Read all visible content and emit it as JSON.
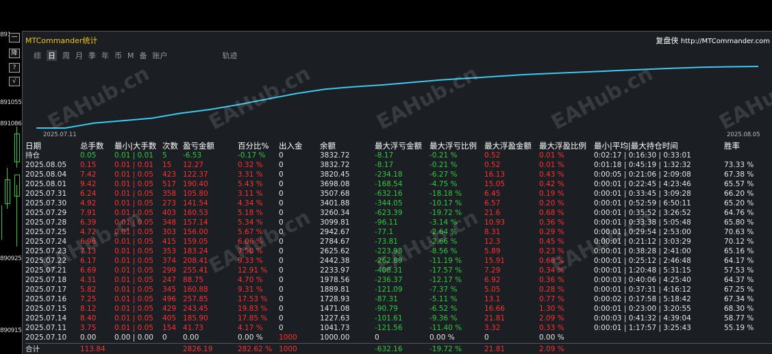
{
  "window": {
    "title": "MTCommander统计",
    "brand": "复盘侠",
    "url": "http://MTCommander.com"
  },
  "tabs": [
    "综",
    "日",
    "周",
    "月",
    "季",
    "年",
    "币",
    "M",
    "备",
    "账户",
    "轨迹"
  ],
  "active_tab": "日",
  "price_labels": [
    "891",
    "891055",
    "891086",
    "890925",
    "890915"
  ],
  "tool_buttons": [
    "一",
    "降",
    "?",
    "√"
  ],
  "chart": {
    "start_label": "2025.07.11",
    "end_label": "2025.08.05",
    "line_color": "#3ec9f2",
    "points": [
      0,
      0,
      0.08,
      0.12,
      0.16,
      0.24,
      0.3,
      0.38,
      0.47,
      0.56,
      0.63,
      0.67,
      0.7,
      0.74,
      0.78,
      0.81,
      0.84,
      0.87,
      0.89,
      0.91,
      0.93,
      0.95,
      0.97,
      0.985,
      0.995,
      1.0
    ]
  },
  "table": {
    "headers": [
      "日期",
      "总手数",
      "最小|大手数",
      "次数",
      "盈亏金额",
      "百分比%",
      "出入金",
      "余额",
      "最大浮亏金额",
      "最大浮亏比例",
      "最大浮盈金额",
      "最大浮盈比例",
      "最小|平均|最大持仓时间",
      "胜率"
    ],
    "holding": {
      "label": "持仓",
      "lots": "0.05",
      "minmax": "0.01 | 0.01",
      "count": "5",
      "pl": "-6.53",
      "pct": "-0.17 %",
      "io": "0",
      "balance": "3832.72",
      "max_float_loss": "-8.17",
      "max_float_loss_pct": "-0.21 %",
      "max_float_profit": "0.52",
      "max_float_profit_pct": "0.01 %",
      "hold_time": "0:02:17 | 0:16:30 | 0:33:01",
      "winrate": ""
    },
    "rows": [
      [
        "2025.08.05",
        "0.15",
        "0.01 | 0.01",
        "15",
        "12.27",
        "0.32 %",
        "0",
        "3832.72",
        "-8.17",
        "-0.21 %",
        "0.52",
        "0.01 %",
        "0:01:18 | 0:45:19 | 1:32:32",
        "73.33 %"
      ],
      [
        "2025.08.04",
        "7.42",
        "0.01 | 0.05",
        "423",
        "122.37",
        "3.31 %",
        "0",
        "3820.45",
        "-234.18",
        "-6.27 %",
        "16.13",
        "0.43 %",
        "0:00:05 | 0:21:06 | 2:09:08",
        "67.38 %"
      ],
      [
        "2025.08.01",
        "9.42",
        "0.01 | 0.05",
        "517",
        "190.40",
        "5.43 %",
        "0",
        "3698.08",
        "-168.54",
        "-4.75 %",
        "15.05",
        "0.42 %",
        "0:00:01 | 0:22:45 | 4:23:46",
        "65.57 %"
      ],
      [
        "2025.07.31",
        "6.24",
        "0.01 | 0.05",
        "358",
        "105.80",
        "3.11 %",
        "0",
        "3507.68",
        "-632.16",
        "-18.18 %",
        "6.45",
        "0.19 %",
        "0:00:01 | 0:33:45 | 3:09:28",
        "66.20 %"
      ],
      [
        "2025.07.30",
        "4.92",
        "0.01 | 0.05",
        "273",
        "141.54",
        "4.34 %",
        "0",
        "3401.88",
        "-344.05",
        "-10.17 %",
        "6.57",
        "0.20 %",
        "0:00:01 | 0:52:59 | 6:50:11",
        "65.20 %"
      ],
      [
        "2025.07.29",
        "7.91",
        "0.01 | 0.05",
        "403",
        "160.53",
        "5.18 %",
        "0",
        "3260.34",
        "-623.39",
        "-19.72 %",
        "21.6",
        "0.68 %",
        "0:00:01 | 0:35:52 | 3:26:52",
        "64.76 %"
      ],
      [
        "2025.07.28",
        "6.39",
        "0.01 | 0.05",
        "348",
        "157.14",
        "5.34 %",
        "0",
        "3099.81",
        "-96.11",
        "-3.14 %",
        "10.93",
        "0.36 %",
        "0:00:01 | 0:33:38 | 5:05:48",
        "65.80 %"
      ],
      [
        "2025.07.25",
        "4.72",
        "0.01 | 0.05",
        "303",
        "156.00",
        "5.67 %",
        "0",
        "2942.67",
        "-77.1",
        "-2.64 %",
        "8.31",
        "0.29 %",
        "0:00:01 | 0:29:54 | 2:53:00",
        "70.63 %"
      ],
      [
        "2025.07.24",
        "6.96",
        "0.01 | 0.05",
        "415",
        "159.05",
        "6.06 %",
        "0",
        "2784.67",
        "-73.81",
        "-2.66 %",
        "12.3",
        "0.45 %",
        "0:00:01 | 0:21:12 | 3:03:29",
        "70.12 %"
      ],
      [
        "2025.07.23",
        "7.13",
        "0.01 | 0.05",
        "353",
        "183.24",
        "7.50 %",
        "0",
        "2625.62",
        "-223.98",
        "-8.56 %",
        "5.89",
        "0.23 %",
        "0:00:01 | 0:38:28 | 2:41:00",
        "65.16 %"
      ],
      [
        "2025.07.22",
        "6.17",
        "0.01 | 0.05",
        "374",
        "208.41",
        "9.33 %",
        "0",
        "2442.38",
        "-262.89",
        "-11.19 %",
        "15.91",
        "0.68 %",
        "0:00:01 | 0:25:12 | 2:46:48",
        "64.17 %"
      ],
      [
        "2025.07.21",
        "6.69",
        "0.01 | 0.05",
        "299",
        "255.41",
        "12.91 %",
        "0",
        "2233.97",
        "-408.31",
        "-17.57 %",
        "7.29",
        "0.34 %",
        "0:00:01 | 1:20:48 | 5:31:15",
        "57.53 %"
      ],
      [
        "2025.07.18",
        "4.31",
        "0.01 | 0.05",
        "247",
        "88.75",
        "4.70 %",
        "0",
        "1978.56",
        "-236.37",
        "-12.17 %",
        "6.92",
        "0.36 %",
        "0:00:03 | 0:40:06 | 4:25:40",
        "64.37 %"
      ],
      [
        "2025.07.17",
        "5.82",
        "0.01 | 0.05",
        "345",
        "160.88",
        "9.31 %",
        "0",
        "1889.81",
        "-121.09",
        "-7.37 %",
        "5.05",
        "0.28 %",
        "0:00:01 | 0:37:31 | 4:16:12",
        "67.25 %"
      ],
      [
        "2025.07.16",
        "7.25",
        "0.01 | 0.05",
        "496",
        "257.85",
        "17.53 %",
        "0",
        "1728.93",
        "-87.31",
        "-5.11 %",
        "13.1",
        "0.77 %",
        "0:00:02 | 0:17:58 | 5:18:42",
        "67.34 %"
      ],
      [
        "2025.07.15",
        "8.12",
        "0.01 | 0.05",
        "429",
        "243.45",
        "19.83 %",
        "0",
        "1471.08",
        "-90.79",
        "-6.52 %",
        "16.66",
        "1.30 %",
        "0:00:01 | 0:23:00 | 3:20:55",
        "68.30 %"
      ],
      [
        "2025.07.14",
        "8.40",
        "0.01 | 0.05",
        "405",
        "185.90",
        "17.85 %",
        "0",
        "1227.63",
        "-101.61",
        "-9.36 %",
        "21.81",
        "2.09 %",
        "0:00:03 | 0:41:32 | 4:39:04",
        "58.77 %"
      ],
      [
        "2025.07.11",
        "3.75",
        "0.01 | 0.05",
        "154",
        "41.73",
        "4.17 %",
        "0",
        "1041.73",
        "-121.56",
        "-11.40 %",
        "3.32",
        "0.33 %",
        "0:00:01 | 1:17:57 | 3:25:43",
        "55.19 %"
      ],
      [
        "2025.07.10",
        "0.00",
        "0.00 | 0.00",
        "0",
        "0.00",
        "0.00 %",
        "1000",
        "1000.00",
        "0",
        "0.00 %",
        "0",
        "0.00 %",
        "",
        ""
      ]
    ],
    "total": [
      "合计",
      "113.84",
      "",
      "",
      "2826.19",
      "282.62 %",
      "1000",
      "",
      "-632.16",
      "-19.72 %",
      "21.81",
      "2.09 %",
      "",
      ""
    ]
  },
  "colors": {
    "background": "#1b1e22",
    "positive": "#ff3030",
    "negative": "#2ecc40",
    "title": "#f0c419"
  },
  "watermarks": [
    "EAHub.cn"
  ]
}
